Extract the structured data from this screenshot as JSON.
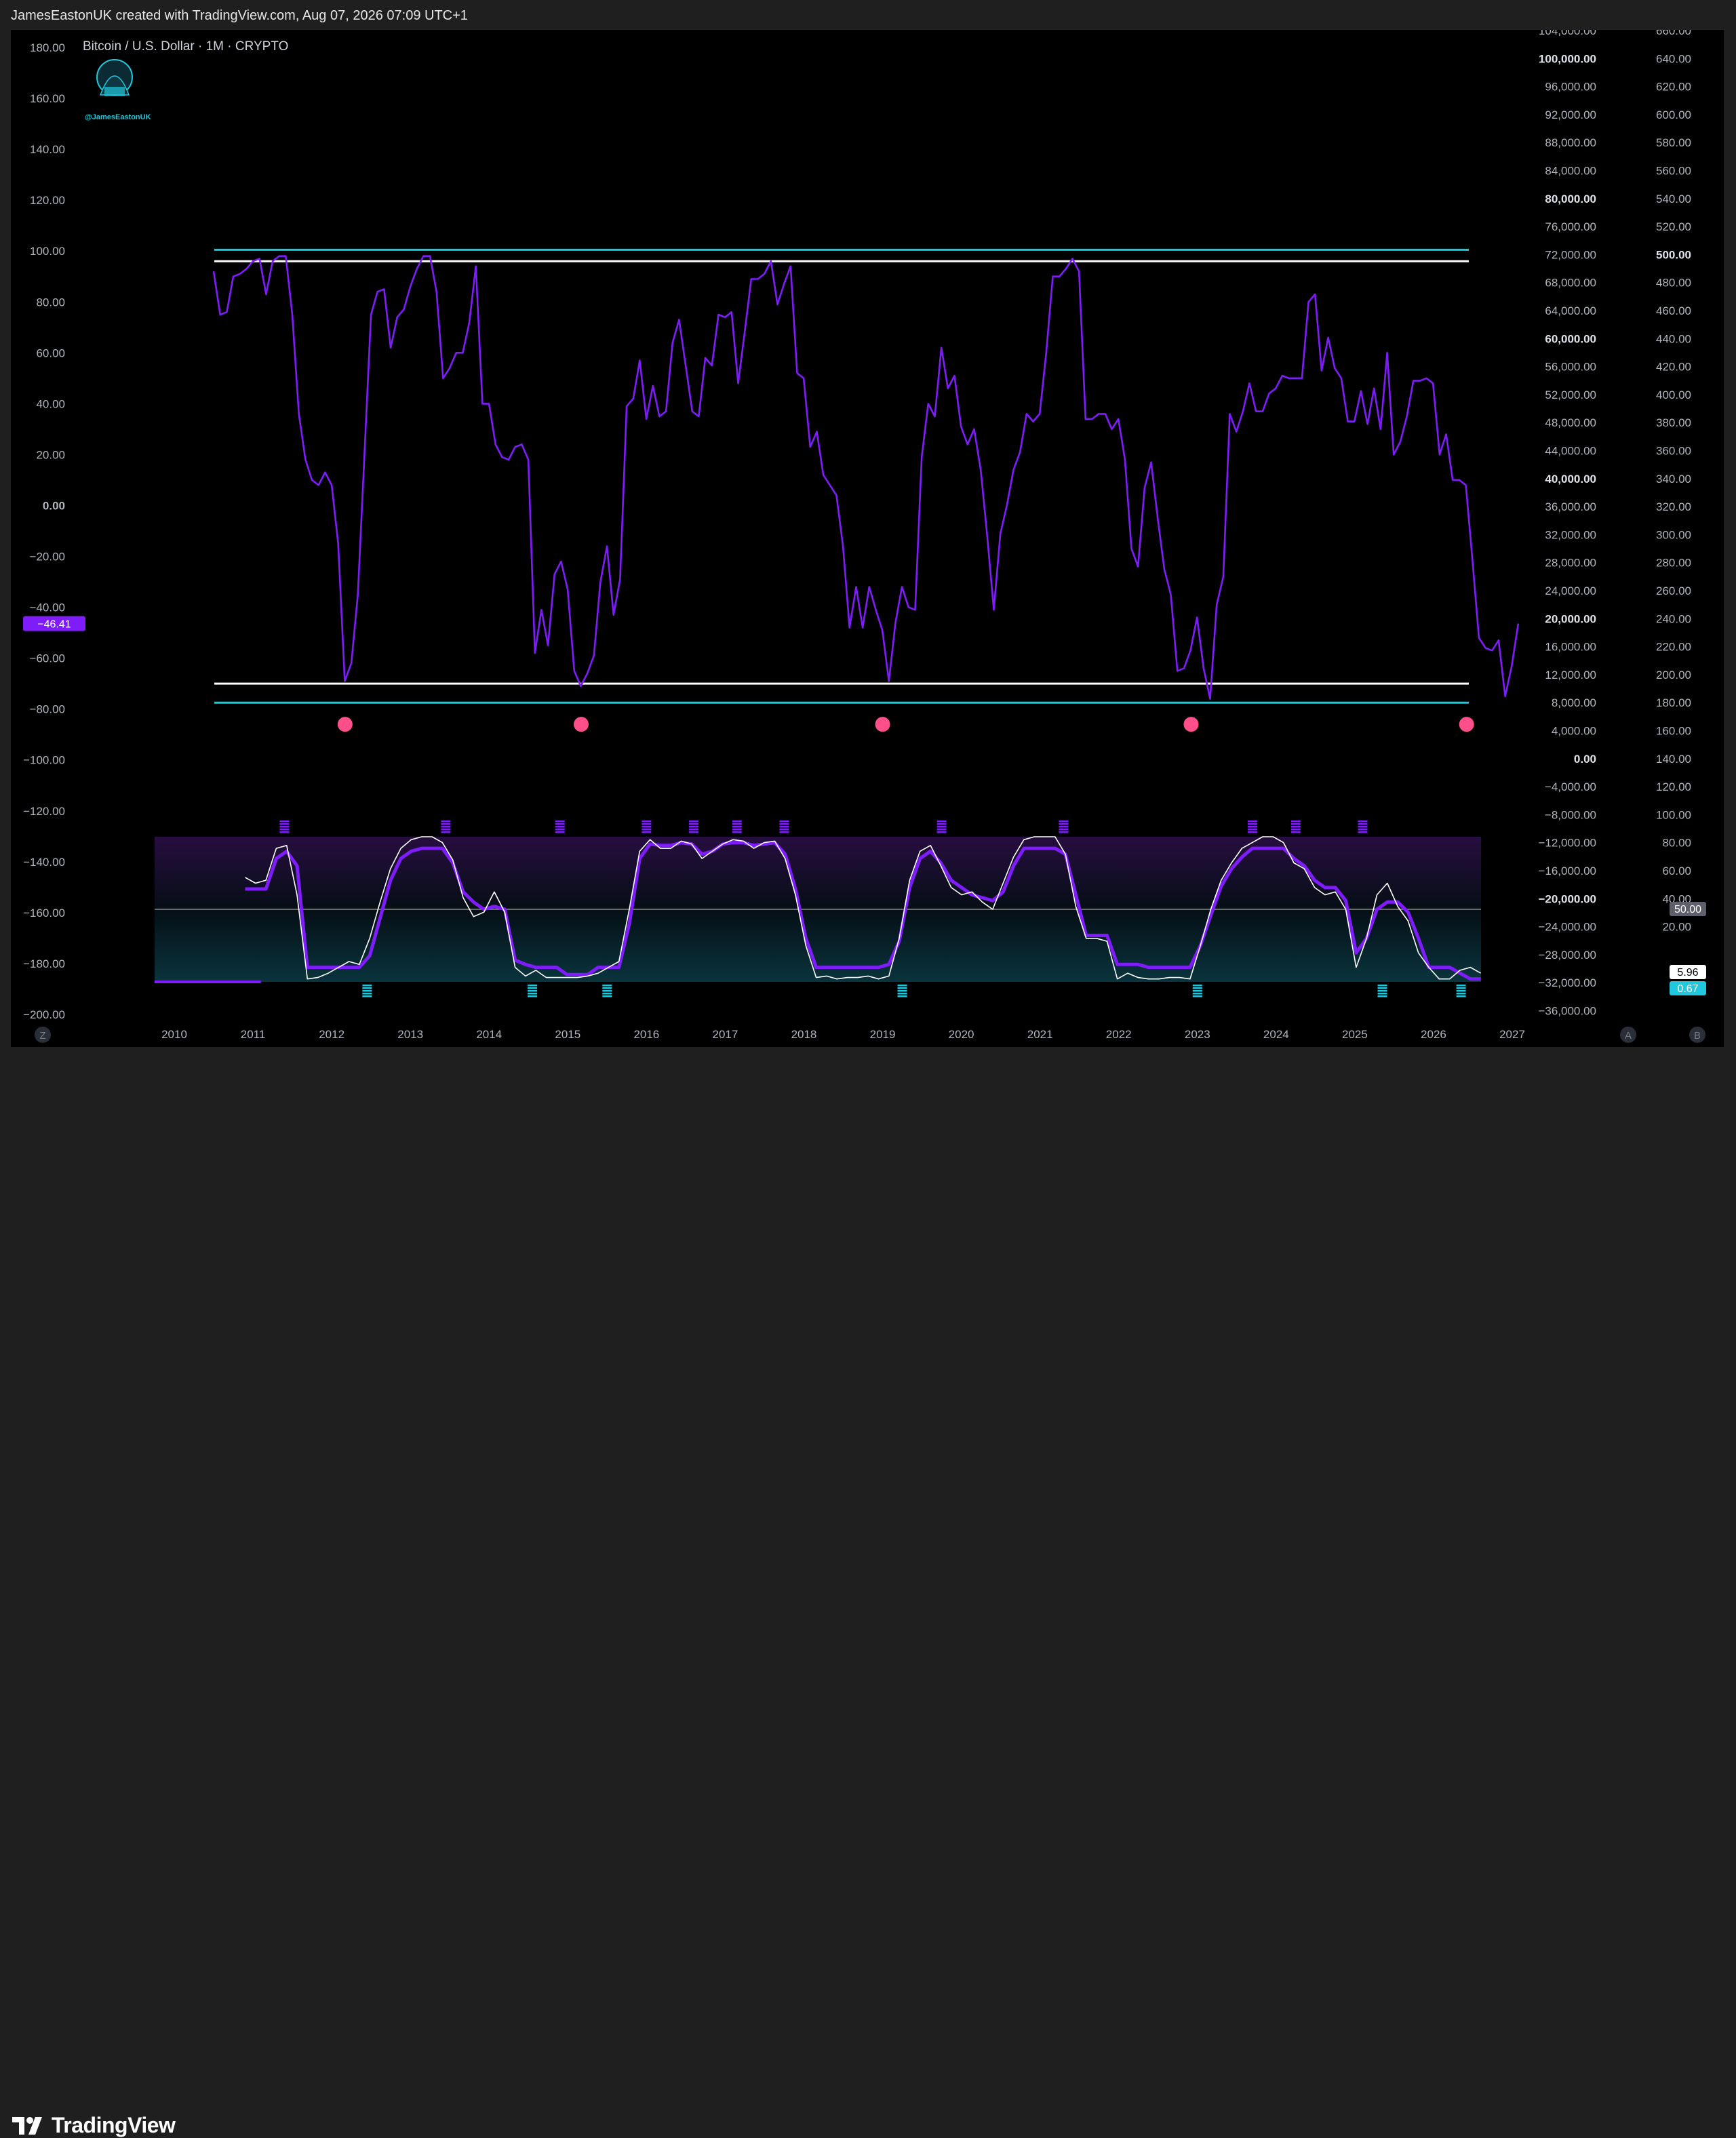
{
  "attribution": "JamesEastonUK created with TradingView.com, Aug 07, 2026 07:09 UTC+1",
  "symbol_title": "Bitcoin / U.S. Dollar · 1M · CRYPTO",
  "watermark_handle": "@JamesEastonUK",
  "brand": "TradingView",
  "colors": {
    "background": "#000000",
    "frame": "#1f1f1f",
    "oscillator": "#7f1dfa",
    "band_cyan": "#21c7dc",
    "band_white": "#ffffff",
    "bottom_marker": "#ff4f8b",
    "stoch_k": "#ffffff",
    "stoch_d_up": "#21c7dc",
    "stoch_d_down": "#7f1dfa",
    "label_bg_purple": "#7f1dfa"
  },
  "scale_buttons": {
    "left": "Z",
    "right_a": "A",
    "right_b": "B"
  },
  "left_axis": {
    "ticks": [
      "180.00",
      "160.00",
      "140.00",
      "120.00",
      "100.00",
      "80.00",
      "60.00",
      "40.00",
      "20.00",
      "0.00",
      "−20.00",
      "−40.00",
      "−60.00",
      "−80.00",
      "−100.00",
      "−120.00",
      "−140.00",
      "−160.00",
      "−180.00",
      "−200.00"
    ],
    "current_label": "−46.41"
  },
  "right_axis_price": {
    "ticks": [
      "104,000.00",
      "100,000.00",
      "96,000.00",
      "92,000.00",
      "88,000.00",
      "84,000.00",
      "80,000.00",
      "76,000.00",
      "72,000.00",
      "68,000.00",
      "64,000.00",
      "60,000.00",
      "56,000.00",
      "52,000.00",
      "48,000.00",
      "44,000.00",
      "40,000.00",
      "36,000.00",
      "32,000.00",
      "28,000.00",
      "24,000.00",
      "20,000.00",
      "16,000.00",
      "12,000.00",
      "8,000.00",
      "4,000.00",
      "0.00",
      "−4,000.00",
      "−8,000.00",
      "−12,000.00",
      "−16,000.00",
      "−20,000.00",
      "−24,000.00",
      "−28,000.00",
      "−32,000.00",
      "−36,000.00"
    ],
    "bold": [
      "100,000.00",
      "80,000.00",
      "60,000.00",
      "40,000.00",
      "20,000.00",
      "0.00",
      "−20,000.00"
    ]
  },
  "right_axis_outer": {
    "ticks": [
      "660.00",
      "640.00",
      "620.00",
      "600.00",
      "580.00",
      "560.00",
      "540.00",
      "520.00",
      "500.00",
      "480.00",
      "460.00",
      "440.00",
      "420.00",
      "400.00",
      "380.00",
      "360.00",
      "340.00",
      "320.00",
      "300.00",
      "280.00",
      "260.00",
      "240.00",
      "220.00",
      "200.00",
      "180.00",
      "160.00",
      "140.00",
      "120.00",
      "100.00",
      "80.00",
      "60.00",
      "40.00",
      "20.00"
    ],
    "bold": [
      "500.00"
    ],
    "labels": [
      {
        "text": "50.00",
        "style": "gray"
      },
      {
        "text": "5.96",
        "style": "white"
      },
      {
        "text": "0.67",
        "style": "cyan"
      }
    ]
  },
  "chart_data": {
    "type": "line",
    "title": "Bitcoin / U.S. Dollar · 1M · CRYPTO",
    "x_ticks": [
      "2010",
      "2011",
      "2012",
      "2013",
      "2014",
      "2015",
      "2016",
      "2017",
      "2018",
      "2019",
      "2020",
      "2021",
      "2022",
      "2023",
      "2024",
      "2025",
      "2026",
      "2027"
    ],
    "y_range": [
      -200,
      180
    ],
    "grid": false,
    "bands": [
      {
        "name": "upper-cyan",
        "value": 100.5,
        "color": "#21c7dc"
      },
      {
        "name": "upper-white",
        "value": 96,
        "color": "#ffffff"
      },
      {
        "name": "lower-white",
        "value": -70,
        "color": "#ffffff"
      },
      {
        "name": "lower-cyan",
        "value": -77.5,
        "color": "#21c7dc"
      }
    ],
    "oscillator": {
      "start_year": 2010.5,
      "step_years": 0.0833,
      "values": [
        92,
        75,
        76,
        90,
        91,
        93,
        96,
        97,
        83,
        96,
        98,
        98,
        75,
        36,
        18,
        10,
        8,
        13,
        8,
        -15,
        -69,
        -62,
        -35,
        20,
        75,
        84,
        85,
        62,
        74,
        77,
        86,
        93,
        98,
        98,
        84,
        50,
        54,
        60,
        60,
        72,
        94,
        40,
        40,
        24,
        19,
        18,
        23,
        24,
        18,
        -58,
        -41,
        -55,
        -27,
        -22,
        -33,
        -65,
        -71,
        -66,
        -59,
        -30,
        -16,
        -43,
        -29,
        39,
        42,
        57,
        34,
        47,
        35,
        37,
        64,
        73,
        55,
        37,
        35,
        58,
        55,
        75,
        74,
        76,
        48,
        68,
        89,
        89,
        91,
        96,
        79,
        87,
        94,
        52,
        50,
        23,
        29,
        12,
        8,
        4,
        -16,
        -48,
        -32,
        -48,
        -32,
        -41,
        -49,
        -69,
        -46,
        -32,
        -40,
        -41,
        19,
        40,
        35,
        62,
        46,
        51,
        31,
        24,
        30,
        14,
        -12,
        -41,
        -11,
        0,
        14,
        21,
        36,
        33,
        36,
        60,
        90,
        90,
        93,
        97,
        92,
        34,
        34,
        36,
        36,
        30,
        34,
        18,
        -17,
        -24,
        7,
        17,
        -5,
        -25,
        -35,
        -65,
        -64,
        -57,
        -44,
        -64,
        -76,
        -39,
        -28,
        36,
        29,
        37,
        48,
        37,
        37,
        44,
        46,
        51,
        50,
        50,
        50,
        80,
        83,
        53,
        66,
        54,
        50,
        33,
        33,
        45,
        32,
        46,
        30,
        60,
        20,
        25,
        35,
        49,
        49,
        50,
        48,
        20,
        28,
        10,
        10,
        8,
        -21,
        -52,
        -56,
        -57,
        -53,
        -75,
        -63,
        -46.41
      ]
    },
    "bottom_markers": [
      2012.17,
      2015.17,
      2019.0,
      2022.92,
      2026.42
    ],
    "stoch_panel": {
      "range": [
        0,
        100
      ],
      "midline": 50,
      "markers_top": [
        2011.4,
        2013.45,
        2014.9,
        2016.0,
        2016.6,
        2017.15,
        2017.75,
        2019.75,
        2021.3,
        2023.7,
        2024.25,
        2025.1
      ],
      "markers_bottom": [
        2012.45,
        2014.55,
        2015.5,
        2019.25,
        2023.0,
        2025.35,
        2026.35
      ],
      "k_values": [
        72,
        68,
        70,
        92,
        94,
        60,
        2,
        3,
        6,
        10,
        14,
        12,
        30,
        55,
        78,
        92,
        98,
        100,
        100,
        96,
        84,
        58,
        45,
        48,
        62,
        48,
        10,
        4,
        8,
        3,
        3,
        3,
        3,
        4,
        6,
        10,
        14,
        50,
        90,
        98,
        92,
        92,
        97,
        95,
        85,
        90,
        95,
        98,
        97,
        92,
        96,
        97,
        85,
        60,
        25,
        3,
        4,
        2,
        3,
        3,
        4,
        2,
        4,
        30,
        70,
        90,
        94,
        80,
        65,
        60,
        62,
        55,
        50,
        68,
        86,
        98,
        100,
        100,
        100,
        88,
        52,
        30,
        30,
        28,
        2,
        6,
        3,
        2,
        2,
        3,
        3,
        2,
        25,
        50,
        70,
        82,
        92,
        96,
        100,
        100,
        96,
        82,
        78,
        65,
        60,
        62,
        50,
        10,
        30,
        60,
        68,
        52,
        42,
        20,
        10,
        2,
        2,
        8,
        10,
        6
      ],
      "d_values": [
        64,
        64,
        64,
        85,
        90,
        80,
        10,
        10,
        10,
        10,
        10,
        10,
        18,
        44,
        70,
        85,
        90,
        92,
        92,
        92,
        82,
        62,
        55,
        50,
        52,
        50,
        15,
        12,
        10,
        10,
        10,
        5,
        5,
        5,
        10,
        10,
        10,
        40,
        85,
        95,
        94,
        94,
        96,
        95,
        88,
        90,
        95,
        96,
        96,
        94,
        95,
        96,
        88,
        64,
        30,
        10,
        10,
        10,
        10,
        10,
        10,
        10,
        12,
        28,
        65,
        85,
        90,
        82,
        70,
        65,
        60,
        58,
        56,
        62,
        80,
        92,
        92,
        92,
        92,
        88,
        60,
        32,
        32,
        32,
        12,
        12,
        12,
        10,
        10,
        10,
        10,
        10,
        25,
        46,
        66,
        78,
        86,
        92,
        92,
        92,
        92,
        85,
        80,
        70,
        65,
        65,
        56,
        20,
        30,
        50,
        55,
        55,
        48,
        30,
        10,
        10,
        10,
        6,
        2,
        2
      ]
    }
  }
}
